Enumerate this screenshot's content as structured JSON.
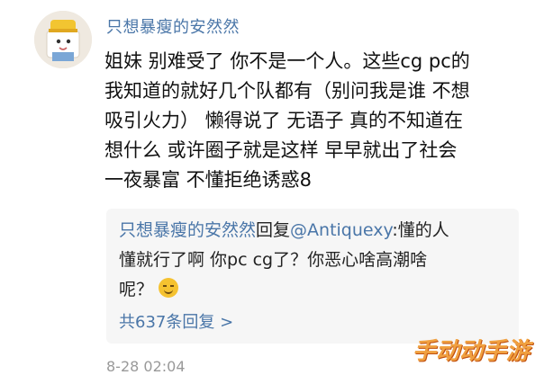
{
  "comment": {
    "username": "只想暴瘦的安然然",
    "lines": [
      "姐妹 别难受了 你不是一个人。这些cg pc的",
      "我知道的就好几个队都有（别问我是谁 不想",
      "吸引火力） 懒得说了 无语子 真的不知道在",
      "想什么 或许圈子就是这样 早早就出了社会",
      "一夜暴富 不懂拒绝诱惑8"
    ],
    "timestamp": "8-28 02:04"
  },
  "reply": {
    "username": "只想暴瘦的安然然",
    "verb": "回复",
    "mention": "@Antiquexy",
    "line1_rest": ":懂的人",
    "line2": "懂就行了啊 你pc cg了？你恶心啥高潮啥",
    "line3": "呢？",
    "emoji": "grinning-sweat-emoji",
    "view_replies": "共637条回复 >"
  },
  "watermark": "手动动手游"
}
